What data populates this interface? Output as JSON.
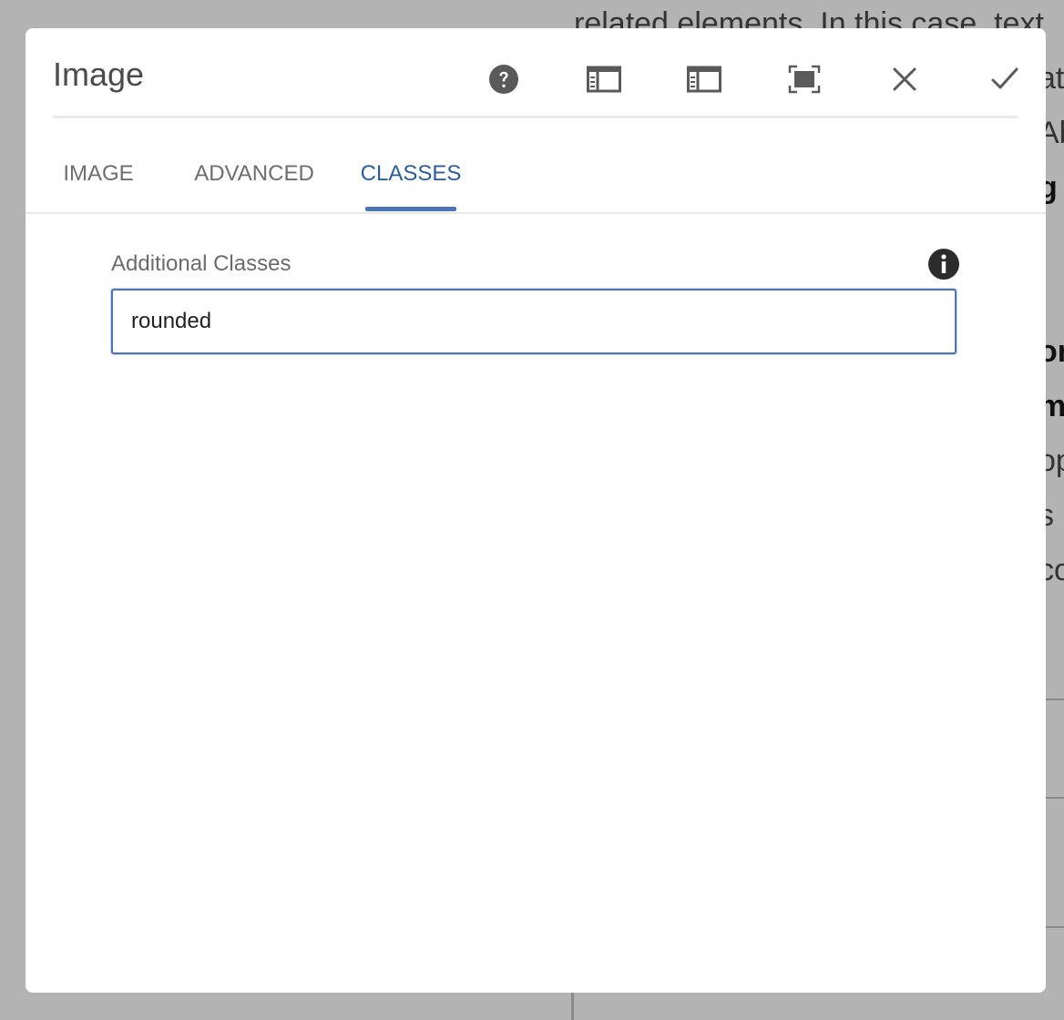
{
  "background": {
    "lines": [
      "related elements. In this case, text",
      "at",
      "Ab",
      "g",
      "on",
      "m",
      "op",
      "s",
      "co"
    ]
  },
  "dialog": {
    "title": "Image",
    "toolbar": {
      "help_icon": "help-icon",
      "toggle_side_panel_icon": "side-panel-icon",
      "toggle_side_panel_alt_icon": "side-panel-icon",
      "fullscreen_icon": "fullscreen-icon",
      "cancel_icon": "close-icon",
      "done_icon": "checkmark-icon"
    },
    "tabs": [
      {
        "label": "IMAGE"
      },
      {
        "label": "ADVANCED"
      },
      {
        "label": "CLASSES"
      }
    ],
    "active_tab": "CLASSES",
    "field": {
      "label": "Additional Classes",
      "value": "rounded",
      "info_icon": "info-icon"
    }
  },
  "colors": {
    "accent": "#4a76b8",
    "active_tab_text": "#2d5d9f",
    "overlay": "#b3b3b3"
  }
}
